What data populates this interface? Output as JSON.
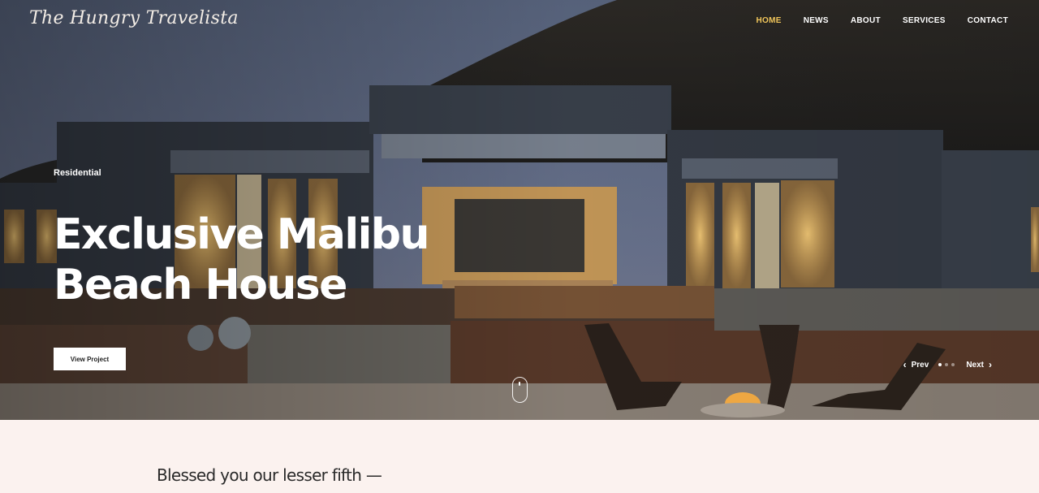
{
  "brand": {
    "name": "The Hungry Travelista"
  },
  "nav": {
    "items": [
      {
        "label": "HOME",
        "active": true
      },
      {
        "label": "NEWS"
      },
      {
        "label": "ABOUT"
      },
      {
        "label": "SERVICES"
      },
      {
        "label": "CONTACT"
      }
    ]
  },
  "hero": {
    "eyebrow": "Residential",
    "headline": "Exclusive Malibu Beach House",
    "cta_label": "View Project",
    "prev_label": "Prev",
    "next_label": "Next",
    "slide_count": 3,
    "active_slide": 1
  },
  "intro": {
    "heading": "Blessed you our lesser fifth —"
  },
  "colors": {
    "accent": "#f0c55a",
    "page_bg": "#fbf2ef"
  },
  "icons": {
    "prev": "chevron-left-icon",
    "next": "chevron-right-icon",
    "scroll": "mouse-scroll-icon"
  }
}
